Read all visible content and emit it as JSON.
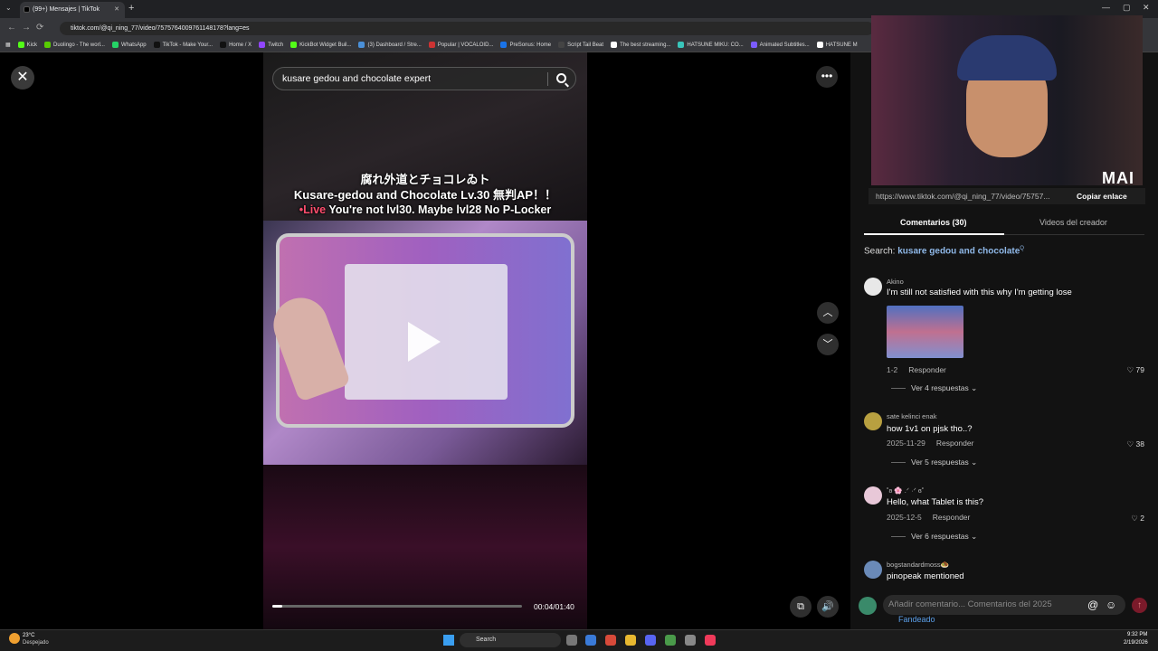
{
  "browser": {
    "tab_title": "(99+) Mensajes | TikTok",
    "url": "tiktok.com/@qi_ning_77/video/7575764009761148178?lang=es",
    "bookmarks": [
      "Kick",
      "Duolingo - The worl...",
      "WhatsApp",
      "TikTok - Make Your...",
      "Home / X",
      "Twitch",
      "KickBot Widget Buil...",
      "(3) Dashboard / Stre...",
      "Popular | VOCALOID...",
      "PreSonus: Home",
      "Script Tail Beat",
      "The best streaming...",
      "HATSUNE MIKU: CO...",
      "Animated Subtitles...",
      "HATSUNE M"
    ],
    "bookmark_colors": [
      "#53fc18",
      "#58cc02",
      "#25d366",
      "#111111",
      "#111111",
      "#9146ff",
      "#53fc18",
      "#4a90d9",
      "#cc3333",
      "#1a73e8",
      "#444444",
      "#ffffff",
      "#39c5bb",
      "#7b5cff",
      "#ffffff"
    ]
  },
  "video": {
    "search_query": "kusare gedou and chocolate expert",
    "caption_line1": "腐れ外道とチョコレゐト",
    "caption_line2": "Kusare-gedou and Chocolate Lv.30 無判AP！！",
    "caption_live": "•Live",
    "caption_line3": " You're not lvl30. Maybe lvl28 No P-Locker",
    "time": "00:04/01:40",
    "progress": 0.04
  },
  "sidebar": {
    "stream_overlay": "MAI",
    "share_link": "https://www.tiktok.com/@qi_ning_77/video/75757...",
    "copy_link": "Copiar enlace",
    "tab_comments": "Comentarios (30)",
    "tab_videos": "Videos del creador",
    "search_prefix": "Search:",
    "search_term": "kusare gedou and chocolate",
    "comments": [
      {
        "user": "Akino",
        "text": "I'm still not satisfied with this why I'm getting lose",
        "date": "1-2",
        "reply": "Responder",
        "likes": "79",
        "more": "Ver 4 respuestas"
      },
      {
        "user": "sate kelinci enak",
        "text": "how 1v1 on pjsk tho..?",
        "date": "2025-11-29",
        "reply": "Responder",
        "likes": "38",
        "more": "Ver 5 respuestas"
      },
      {
        "user": "˚ʚ 🌸 .ᐟ ·ᐟ ɞ˚",
        "text": "Hello, what Tablet is this?",
        "date": "2025-12-5",
        "reply": "Responder",
        "likes": "2",
        "more": "Ver 6 respuestas"
      },
      {
        "user": "bogstandardmoss🧆",
        "text": "pinopeak mentioned"
      }
    ],
    "comment_placeholder": "Añadir comentario... Comentarios del 2025",
    "fandeado": "Fandeado"
  },
  "taskbar": {
    "temp": "23°C",
    "weather": "Despejado",
    "search": "Search",
    "time": "9:32 PM",
    "date": "2/19/2026"
  }
}
